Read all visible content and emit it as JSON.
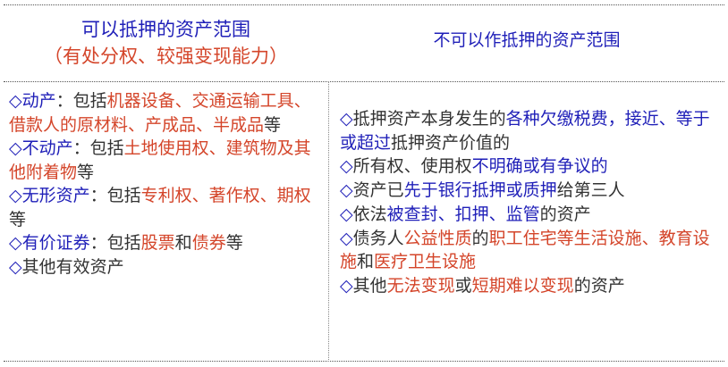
{
  "header": {
    "left_title": "可以抵押的资产范围",
    "left_subtitle": "（有处分权、较强变现能力）",
    "right_title": "不可以作抵押的资产范围"
  },
  "left_items": [
    {
      "bullet": "◇",
      "parts": [
        {
          "text": "动产",
          "color": "blue"
        },
        {
          "text": "：包括",
          "color": "dark"
        },
        {
          "text": "机器设备、交通运输工具、借款人的原材料、产成品、半成品",
          "color": "red"
        },
        {
          "text": "等",
          "color": "dark"
        }
      ]
    },
    {
      "bullet": "◇",
      "parts": [
        {
          "text": "不动产",
          "color": "blue"
        },
        {
          "text": "：包括",
          "color": "dark"
        },
        {
          "text": "土地使用权、建筑物及其他附着物",
          "color": "red"
        },
        {
          "text": "等",
          "color": "dark"
        }
      ]
    },
    {
      "bullet": "◇",
      "parts": [
        {
          "text": "无形资产",
          "color": "blue"
        },
        {
          "text": "：包括",
          "color": "dark"
        },
        {
          "text": "专利权、著作权、期权",
          "color": "red"
        },
        {
          "text": "等",
          "color": "dark"
        }
      ]
    },
    {
      "bullet": "◇",
      "parts": [
        {
          "text": "有价证券",
          "color": "blue"
        },
        {
          "text": "：包括",
          "color": "dark"
        },
        {
          "text": "股票",
          "color": "red"
        },
        {
          "text": "和",
          "color": "dark"
        },
        {
          "text": "债券",
          "color": "red"
        },
        {
          "text": "等",
          "color": "dark"
        }
      ]
    },
    {
      "bullet": "◇",
      "parts": [
        {
          "text": "其他有效资产",
          "color": "dark"
        }
      ]
    }
  ],
  "right_items": [
    {
      "bullet": "◇",
      "parts": [
        {
          "text": "抵押资产本身发生的",
          "color": "dark"
        },
        {
          "text": "各种欠缴税费，接近、等于或超过",
          "color": "blue"
        },
        {
          "text": "抵押资产价值的",
          "color": "dark"
        }
      ]
    },
    {
      "bullet": "◇",
      "parts": [
        {
          "text": "所有权、使用权",
          "color": "dark"
        },
        {
          "text": "不明确或有争议的",
          "color": "blue"
        }
      ]
    },
    {
      "bullet": "◇",
      "parts": [
        {
          "text": "资产已",
          "color": "dark"
        },
        {
          "text": "先于银行抵押或质押",
          "color": "blue"
        },
        {
          "text": "给第三人",
          "color": "dark"
        }
      ]
    },
    {
      "bullet": "◇",
      "parts": [
        {
          "text": "依法",
          "color": "dark"
        },
        {
          "text": "被查封、扣押、监管",
          "color": "blue"
        },
        {
          "text": "的资产",
          "color": "dark"
        }
      ]
    },
    {
      "bullet": "◇",
      "parts": [
        {
          "text": "债务人",
          "color": "dark"
        },
        {
          "text": "公益性质",
          "color": "red"
        },
        {
          "text": "的",
          "color": "dark"
        },
        {
          "text": "职工住宅等生活设施、教育设施",
          "color": "red"
        },
        {
          "text": "和",
          "color": "dark"
        },
        {
          "text": "医疗卫生设施",
          "color": "red"
        }
      ]
    },
    {
      "bullet": "◇",
      "parts": [
        {
          "text": "其他",
          "color": "dark"
        },
        {
          "text": "无法变现",
          "color": "red"
        },
        {
          "text": "或",
          "color": "dark"
        },
        {
          "text": "短期难以变现",
          "color": "red"
        },
        {
          "text": "的资产",
          "color": "dark"
        }
      ]
    }
  ]
}
